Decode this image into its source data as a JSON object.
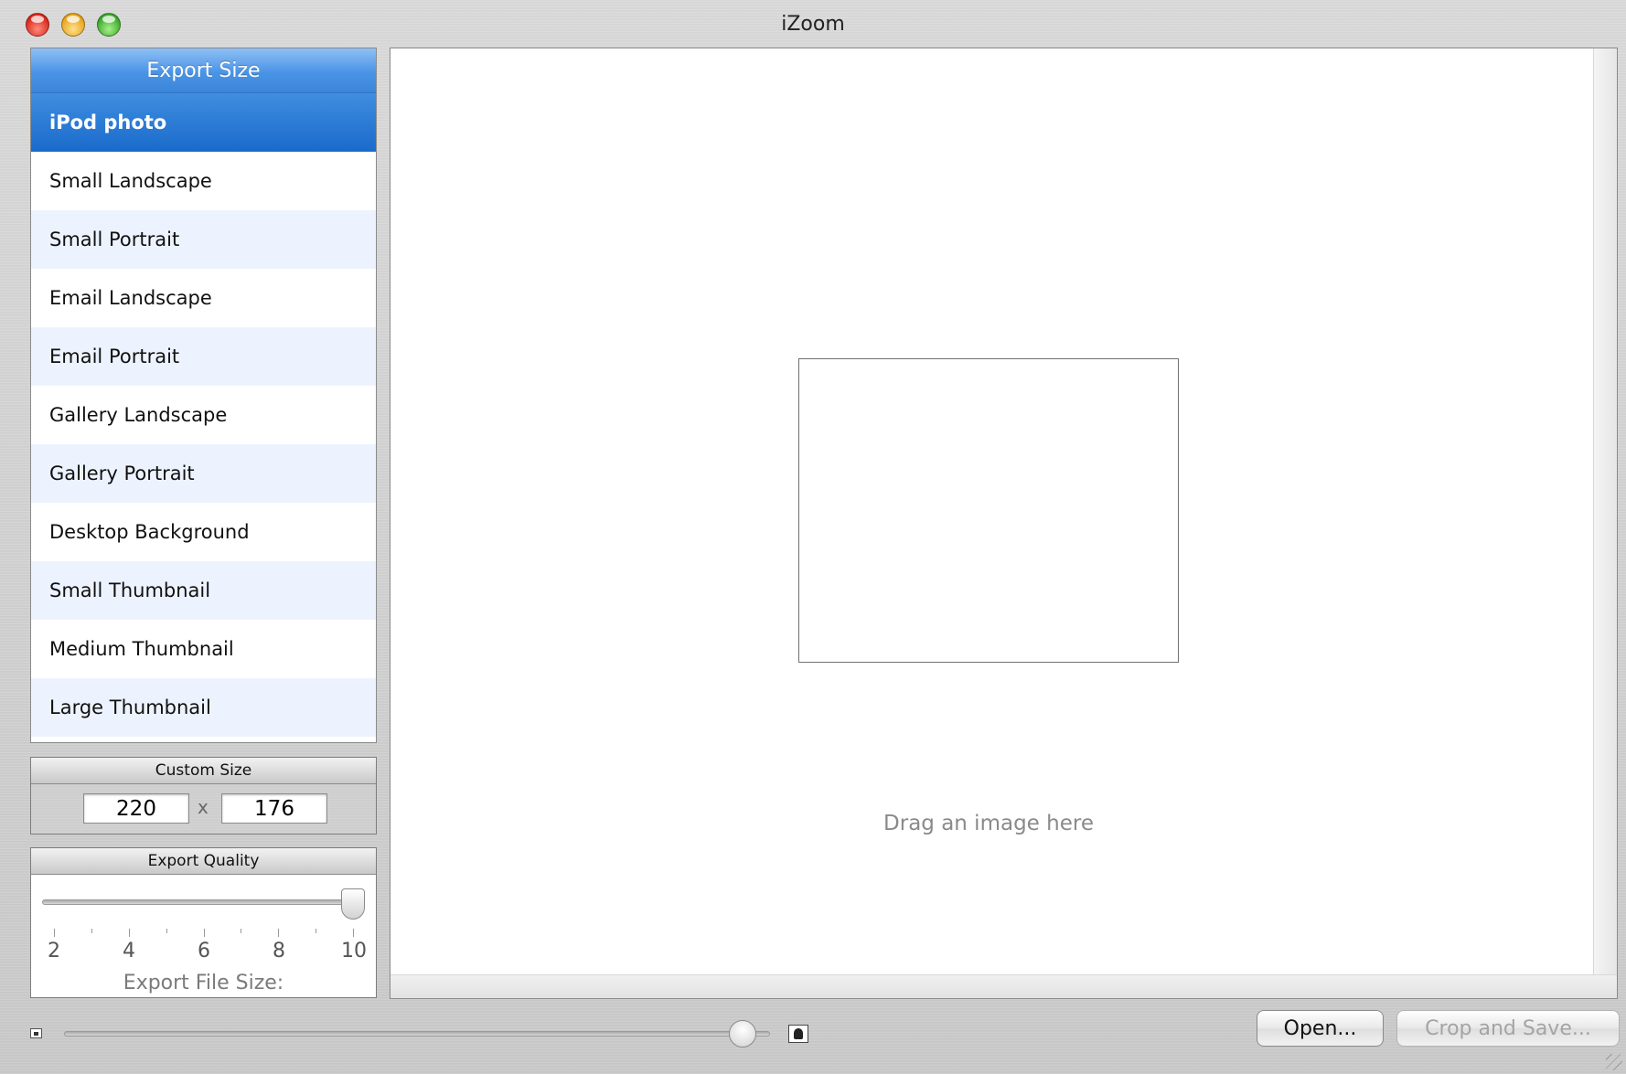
{
  "window": {
    "title": "iZoom"
  },
  "export_size": {
    "header": "Export Size",
    "selected_index": 0,
    "items": [
      {
        "label": "iPod photo"
      },
      {
        "label": "Small Landscape"
      },
      {
        "label": "Small Portrait"
      },
      {
        "label": "Email Landscape"
      },
      {
        "label": "Email Portrait"
      },
      {
        "label": "Gallery Landscape"
      },
      {
        "label": "Gallery Portrait"
      },
      {
        "label": "Desktop Background"
      },
      {
        "label": "Small Thumbnail"
      },
      {
        "label": "Medium Thumbnail"
      },
      {
        "label": "Large Thumbnail"
      }
    ]
  },
  "custom_size": {
    "header": "Custom Size",
    "width": "220",
    "separator": "x",
    "height": "176"
  },
  "export_quality": {
    "header": "Export Quality",
    "min": 2,
    "max": 10,
    "value": 10,
    "tick_labels": [
      "2",
      "4",
      "6",
      "8",
      "10"
    ],
    "file_size_label": "Export File Size:"
  },
  "canvas": {
    "drop_hint": "Drag an image here"
  },
  "zoom": {
    "value_fraction": 0.98,
    "small_icon": "small-image-icon",
    "large_icon": "large-portrait-icon"
  },
  "buttons": {
    "open_label": "Open...",
    "crop_save_label": "Crop and Save...",
    "crop_save_enabled": false
  },
  "colors": {
    "selection": "#1a6acb",
    "header_blue": "#4a94e6",
    "row_alt": "#edf3fe"
  }
}
